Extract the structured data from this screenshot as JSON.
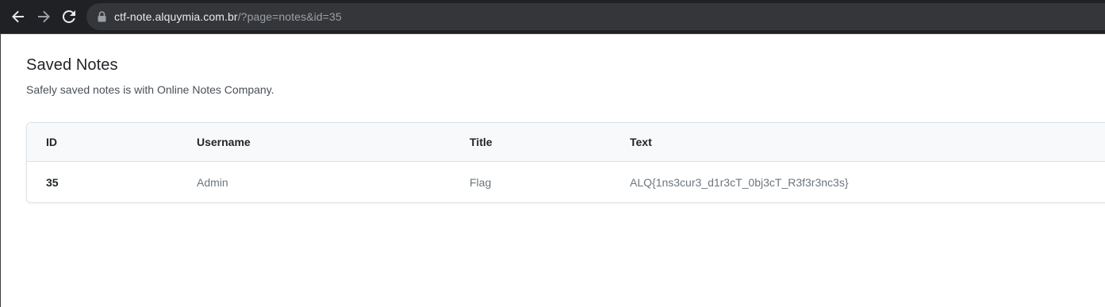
{
  "browser": {
    "url_host": "ctf-note.alquymia.com.br",
    "url_path": "/?page=notes&id=35",
    "icons": {
      "back": "arrow-left-icon",
      "forward": "arrow-right-icon",
      "reload": "reload-icon",
      "lock": "lock-icon"
    }
  },
  "page": {
    "title": "Saved Notes",
    "subtitle": "Safely saved notes is with Online Notes Company."
  },
  "table": {
    "columns": [
      "ID",
      "Username",
      "Title",
      "Text"
    ],
    "rows": [
      {
        "id": "35",
        "username": "Admin",
        "title": "Flag",
        "text": "ALQ{1ns3cur3_d1r3cT_0bj3cT_R3f3r3nc3s}"
      }
    ]
  },
  "colors": {
    "chrome_bg": "#202124",
    "omnibox_bg": "#35363a",
    "text_primary": "#212529",
    "text_muted": "#6c757d",
    "table_header_bg": "#f8f9fa",
    "border": "#dee2e6"
  }
}
